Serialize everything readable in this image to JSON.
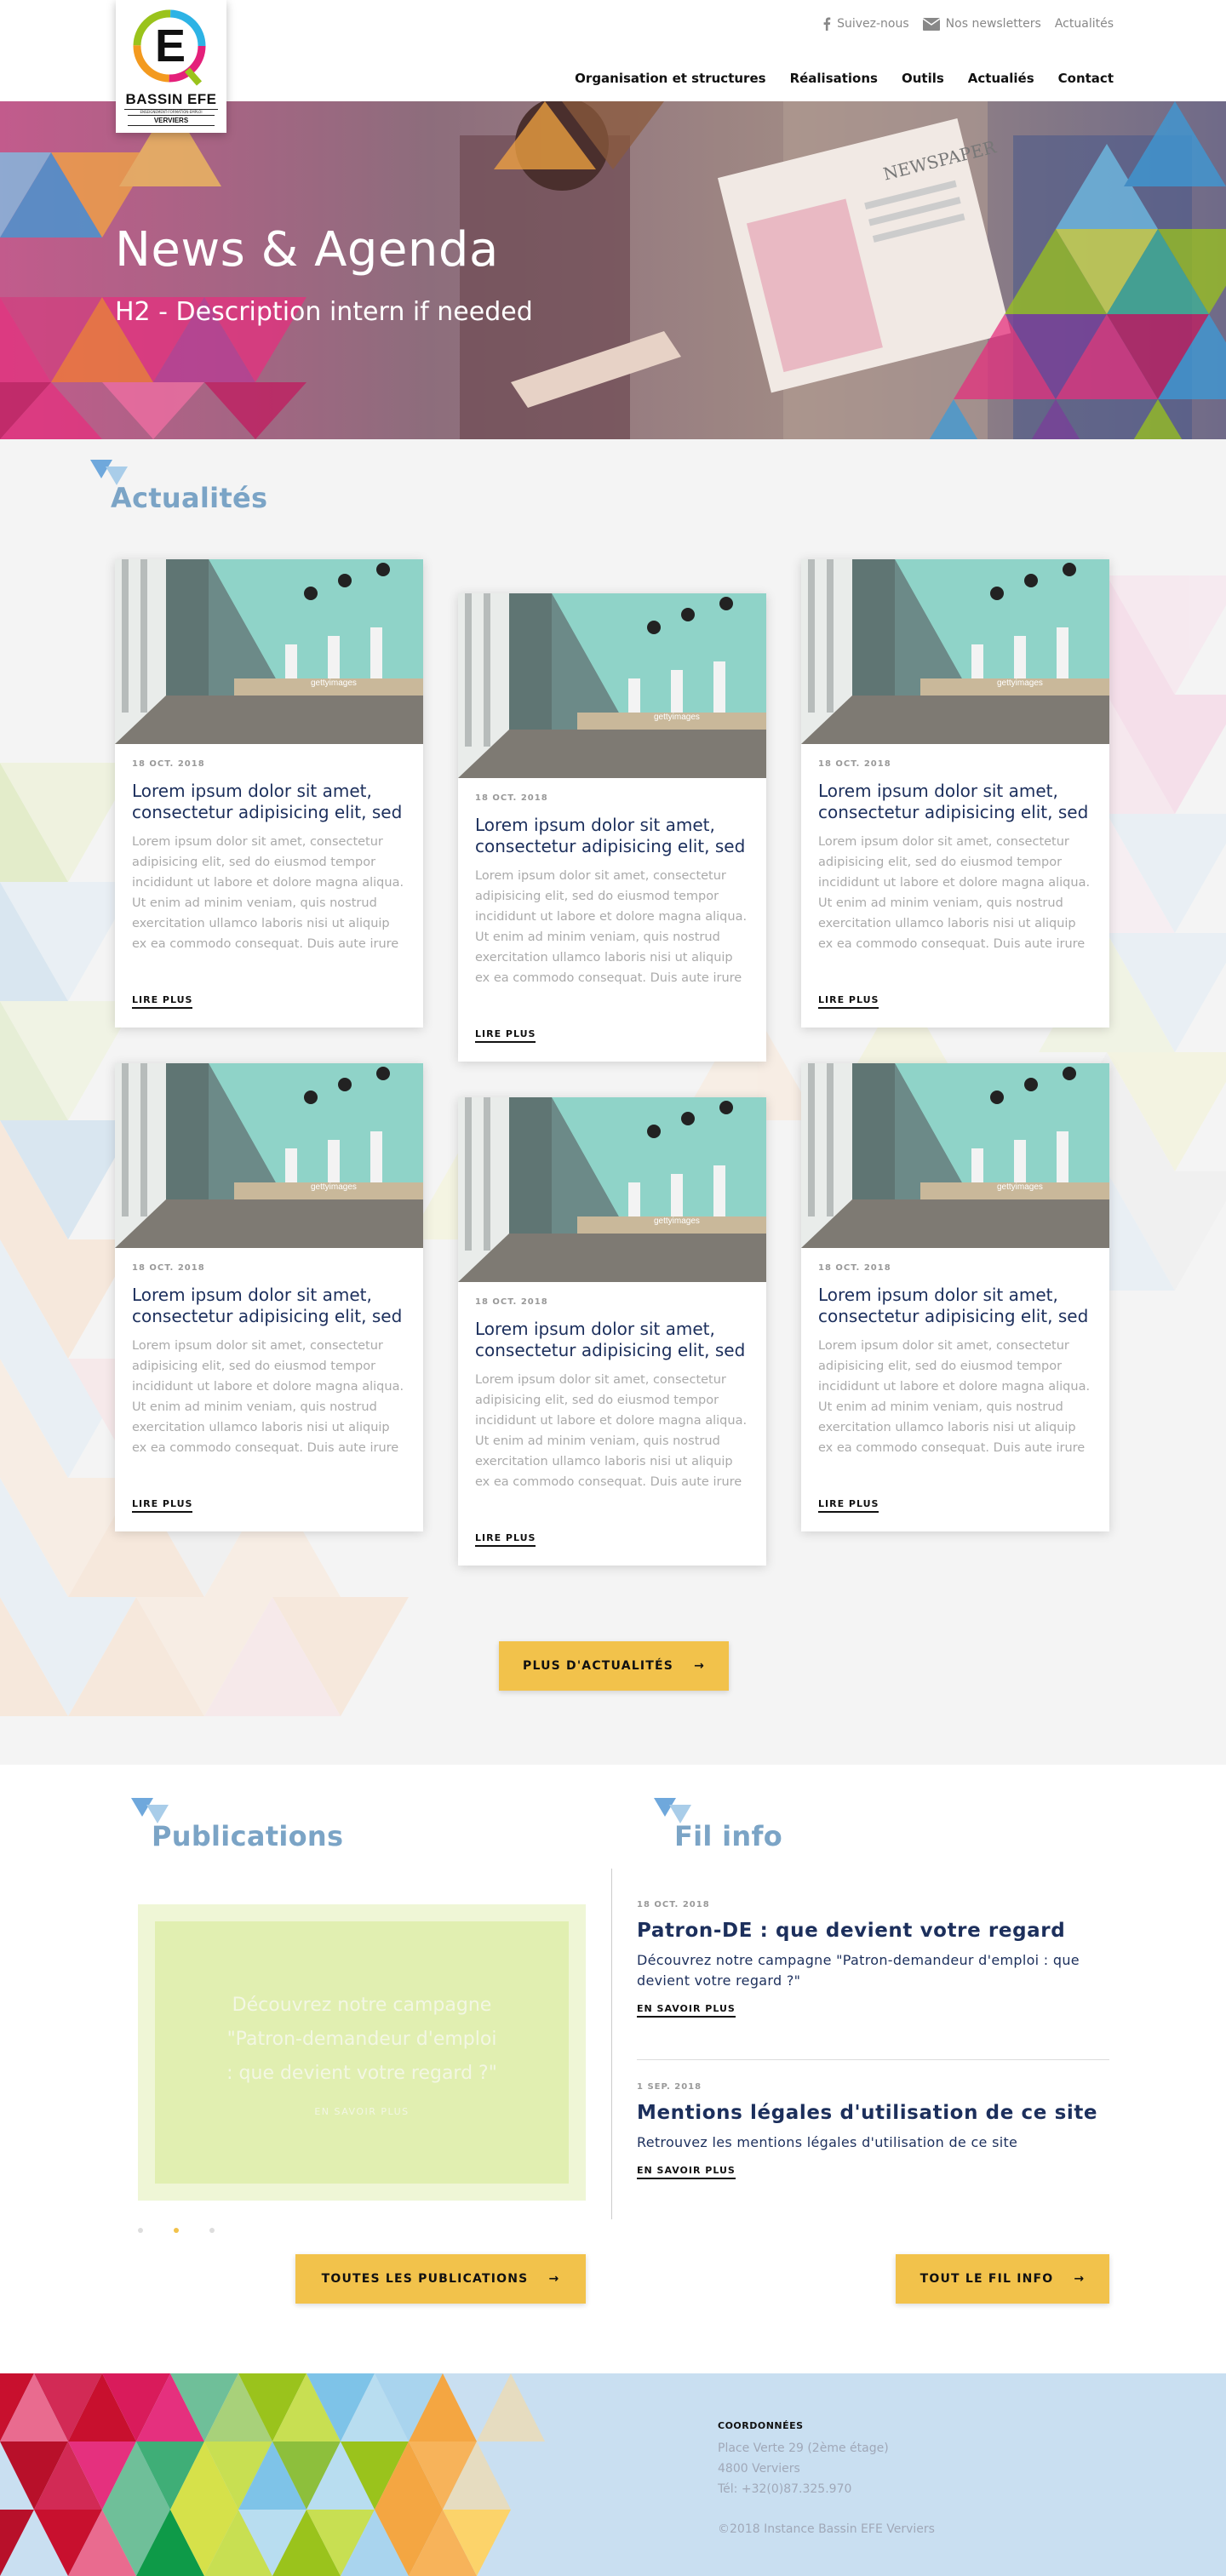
{
  "brand": {
    "logo_letter": "E",
    "name": "BASSIN EFE",
    "tagline": "ENSEIGNEMENT-FORMATION-EMPLOI",
    "city": "VERVIERS"
  },
  "topbar": {
    "follow": "Suivez-nous",
    "newsletters": "Nos newsletters",
    "news": "Actualités"
  },
  "nav": [
    "Organisation et structures",
    "Réalisations",
    "Outils",
    "Actualiés",
    "Contact"
  ],
  "hero": {
    "title": "News & Agenda",
    "subtitle": "H2 - Description intern if needed",
    "newspaper_text": "NEWSPAPER"
  },
  "news": {
    "heading": "Actualités",
    "image_watermark": "gettyimages",
    "cards": [
      {
        "date": "18 OCT. 2018",
        "title": "Lorem ipsum dolor sit amet, consectetur adipisicing elit, sed",
        "text": "Lorem ipsum dolor sit amet, consectetur adipisicing elit, sed do eiusmod tempor incididunt ut labore et dolore magna aliqua. Ut enim ad minim veniam, quis nostrud exercitation ullamco laboris nisi ut aliquip ex ea commodo consequat. Duis aute irure dolor in reprehenderit in voluptate velit",
        "more": "LIRE PLUS"
      },
      {
        "date": "18 OCT. 2018",
        "title": "Lorem ipsum dolor sit amet, consectetur adipisicing elit, sed",
        "text": "Lorem ipsum dolor sit amet, consectetur adipisicing elit, sed do eiusmod tempor incididunt ut labore et dolore magna aliqua. Ut enim ad minim veniam, quis nostrud exercitation ullamco laboris nisi ut aliquip ex ea commodo consequat. Duis aute irure dolor in reprehenderit in voluptate velit",
        "more": "LIRE PLUS"
      },
      {
        "date": "18 OCT. 2018",
        "title": "Lorem ipsum dolor sit amet, consectetur adipisicing elit, sed",
        "text": "Lorem ipsum dolor sit amet, consectetur adipisicing elit, sed do eiusmod tempor incididunt ut labore et dolore magna aliqua. Ut enim ad minim veniam, quis nostrud exercitation ullamco laboris nisi ut aliquip ex ea commodo consequat. Duis aute irure dolor in reprehenderit in voluptate velit",
        "more": "LIRE PLUS"
      },
      {
        "date": "18 OCT. 2018",
        "title": "Lorem ipsum dolor sit amet, consectetur adipisicing elit, sed",
        "text": "Lorem ipsum dolor sit amet, consectetur adipisicing elit, sed do eiusmod tempor incididunt ut labore et dolore magna aliqua. Ut enim ad minim veniam, quis nostrud exercitation ullamco laboris nisi ut aliquip ex ea commodo consequat. Duis aute irure dolor in reprehenderit in voluptate velit",
        "more": "LIRE PLUS"
      },
      {
        "date": "18 OCT. 2018",
        "title": "Lorem ipsum dolor sit amet, consectetur adipisicing elit, sed",
        "text": "Lorem ipsum dolor sit amet, consectetur adipisicing elit, sed do eiusmod tempor incididunt ut labore et dolore magna aliqua. Ut enim ad minim veniam, quis nostrud exercitation ullamco laboris nisi ut aliquip ex ea commodo consequat. Duis aute irure dolor in reprehenderit in voluptate velit",
        "more": "LIRE PLUS"
      },
      {
        "date": "18 OCT. 2018",
        "title": "Lorem ipsum dolor sit amet, consectetur adipisicing elit, sed",
        "text": "Lorem ipsum dolor sit amet, consectetur adipisicing elit, sed do eiusmod tempor incididunt ut labore et dolore magna aliqua. Ut enim ad minim veniam, quis nostrud exercitation ullamco laboris nisi ut aliquip ex ea commodo consequat. Duis aute irure dolor in reprehenderit in voluptate velit",
        "more": "LIRE PLUS"
      }
    ],
    "more_button": "PLUS D'ACTUALITÉS"
  },
  "publications": {
    "heading": "Publications",
    "slide_text": "Découvrez notre campagne \"Patron-demandeur d'emploi : que devient votre regard ?\"",
    "slide_more": "EN SAVOIR PLUS",
    "active_slide": 2,
    "slide_count": 3,
    "button": "TOUTES LES PUBLICATIONS"
  },
  "fil_info": {
    "heading": "Fil info",
    "items": [
      {
        "date": "18 OCT. 2018",
        "title": "Patron-DE : que devient votre regard",
        "desc": "Découvrez notre campagne \"Patron-demandeur d'emploi : que devient votre regard ?\"",
        "more": "EN SAVOIR PLUS"
      },
      {
        "date": "1 SEP. 2018",
        "title": "Mentions légales d'utilisation de ce site",
        "desc": "Retrouvez les mentions légales d'utilisation de ce site",
        "more": "EN SAVOIR PLUS"
      }
    ],
    "button": "TOUT LE FIL INFO"
  },
  "footer": {
    "heading": "COORDONNÉES",
    "address1": "Place Verte 29 (2ème étage)",
    "address2": "4800 Verviers",
    "phone": "Tél: +32(0)87.325.970",
    "copyright": "©2018 Instance Bassin EFE Verviers"
  },
  "colors": {
    "accent_yellow": "#f2c24b",
    "heading_blue": "#7ba4c6",
    "title_navy": "#1c2f5c"
  }
}
